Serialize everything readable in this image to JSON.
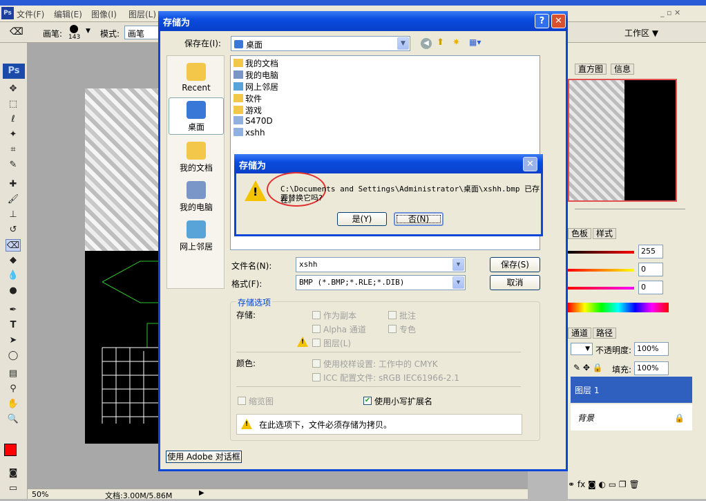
{
  "photoshop": {
    "menu": [
      "文件(F)",
      "编辑(E)",
      "图像(I)",
      "图层(L)"
    ],
    "toolbar": {
      "brush_label": "画笔:",
      "brush_size": "143",
      "mode_label": "模式:",
      "mode_value": "画笔"
    },
    "workspace_label": "工作区 ▼",
    "status": {
      "zoom": "50%",
      "doc_size": "文档:3.00M/5.86M"
    },
    "panels": {
      "histogram_tab": "直方图",
      "info_tab": "信息",
      "swatches_tab": "色板",
      "styles_tab": "样式",
      "color_values": [
        "255",
        "0",
        "0"
      ],
      "channels_tab": "通道",
      "paths_tab": "路径",
      "opacity_label": "不透明度:",
      "opacity_value": "100%",
      "fill_label": "填充:",
      "fill_value": "100%",
      "layers": [
        "图层 1",
        "背景"
      ]
    },
    "accent_color": "#2f5fbf",
    "foreground_color": "#ff0000"
  },
  "save_dialog": {
    "title": "存储为",
    "save_in_label": "保存在(I):",
    "save_in_value": "桌面",
    "places": [
      "Recent",
      "桌面",
      "我的文档",
      "我的电脑",
      "网上邻居"
    ],
    "files": [
      "我的文档",
      "我的电脑",
      "网上邻居",
      "软件",
      "游戏",
      "S470D",
      "xshh"
    ],
    "filename_label": "文件名(N):",
    "filename_value": "xshh",
    "format_label": "格式(F):",
    "format_value": "BMP (*.BMP;*.RLE;*.DIB)",
    "save_button": "保存(S)",
    "cancel_button": "取消",
    "options_title": "存储选项",
    "store_label": "存储:",
    "as_copy": "作为副本",
    "annotations": "批注",
    "alpha": "Alpha 通道",
    "spot": "专色",
    "layers": "图层(L)",
    "color_label": "颜色:",
    "proof": "使用校样设置: 工作中的 CMYK",
    "icc": "ICC 配置文件: sRGB IEC61966-2.1",
    "thumbnail": "缩览图",
    "lowercase_ext": "使用小写扩展名",
    "warning_text": "在此选项下，文件必须存储为拷贝。",
    "adobe_dialog_button": "使用 Adobe 对话框"
  },
  "confirm_dialog": {
    "title": "存储为",
    "message_line1": "C:\\Documents and Settings\\Administrator\\桌面\\xshh.bmp 已存在。",
    "message_line2": "要替换它吗?",
    "yes_button": "是(Y)",
    "no_button": "否(N)"
  }
}
